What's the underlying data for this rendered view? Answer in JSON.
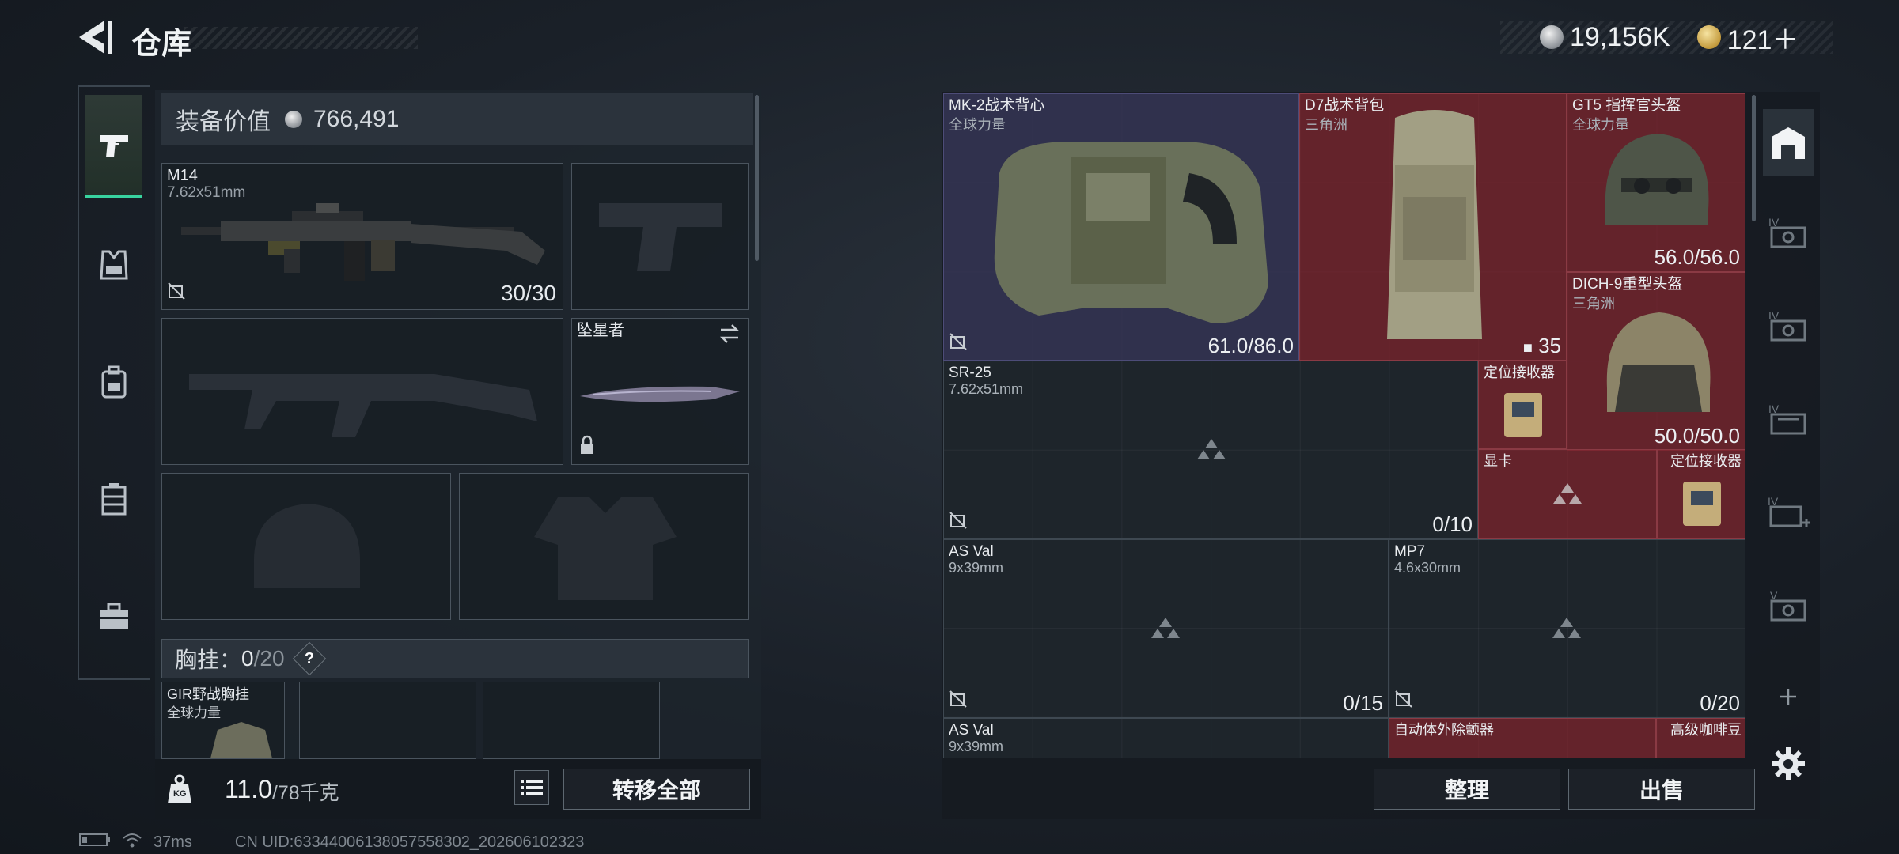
{
  "header": {
    "title": "仓库",
    "currency_silver": "19,156K",
    "currency_gold": "121＋"
  },
  "loadout": {
    "value_label": "装备价值",
    "value": "766,491",
    "primary_weapon": {
      "name": "M14",
      "ammo_type": "7.62x51mm",
      "ammo": "30/30"
    },
    "melee": {
      "name": "坠星者"
    },
    "chest_rig_label": "胸挂：",
    "chest_rig_current": "0",
    "chest_rig_max": "/20",
    "chest_rig_help": "?",
    "chest_rig_item": {
      "name": "GIR野战胸挂",
      "sub": "全球力量"
    },
    "weight_current": "11.0",
    "weight_max": "/78千克",
    "weight_icon_text": "KG",
    "transfer_all": "转移全部"
  },
  "status": {
    "ping": "37ms",
    "uid": "CN UID:63344006138057558302_202606102323"
  },
  "stash": {
    "items": [
      {
        "id": "vest",
        "name": "MK-2战术背心",
        "sub": "全球力量",
        "value": "61.0/86.0"
      },
      {
        "id": "backpack",
        "name": "D7战术背包",
        "sub": "三角洲",
        "value": "35"
      },
      {
        "id": "helmet1",
        "name": "GT5 指挥官头盔",
        "sub": "全球力量",
        "value": "56.0/56.0"
      },
      {
        "id": "helmet2",
        "name": "DICH-9重型头盔",
        "sub": "三角洲",
        "value": "50.0/50.0"
      },
      {
        "id": "sr25",
        "name": "SR-25",
        "sub": "7.62x51mm",
        "value": "0/10"
      },
      {
        "id": "locator1",
        "name": "定位接收器"
      },
      {
        "id": "gpu",
        "name": "显卡"
      },
      {
        "id": "locator2",
        "name": "定位接收器"
      },
      {
        "id": "asval1",
        "name": "AS Val",
        "sub": "9x39mm",
        "value": "0/15"
      },
      {
        "id": "mp7",
        "name": "MP7",
        "sub": "4.6x30mm",
        "value": "0/20"
      },
      {
        "id": "asval2",
        "name": "AS Val",
        "sub": "9x39mm"
      },
      {
        "id": "aed",
        "name": "自动体外除颤器"
      },
      {
        "id": "coffee",
        "name": "高级咖啡豆"
      }
    ],
    "sort_button": "整理",
    "sell_button": "出售"
  },
  "colors": {
    "accent_green": "#38d39f",
    "rare_red": "#78222c",
    "epic_purple": "#343454"
  },
  "icons": {
    "left_rail": [
      "pistol-icon",
      "armor-vest-icon",
      "backpack-icon",
      "chest-rig-icon",
      "toolbox-icon"
    ],
    "right_rail": [
      "stash-home-icon",
      "stash-iv-icon",
      "stash-iv-icon",
      "stash-iv-icon",
      "stash-iv-add-icon",
      "stash-v-icon",
      "add-icon",
      "gear-icon"
    ]
  }
}
